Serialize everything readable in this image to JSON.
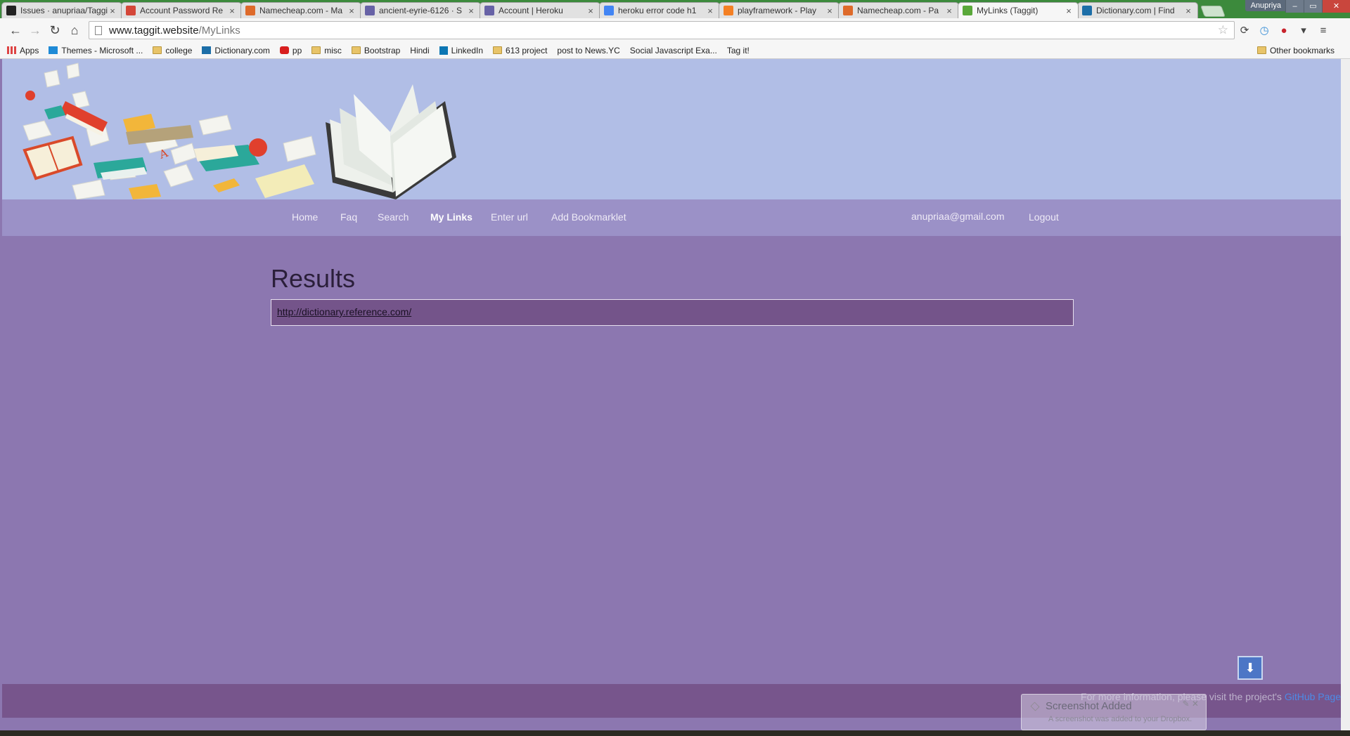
{
  "browser": {
    "tabs": [
      {
        "title": "Issues · anupriaa/Taggit",
        "favicon": "github-icon",
        "color": "#222222"
      },
      {
        "title": "Account Password Re",
        "favicon": "gmail-icon",
        "color": "#d44638"
      },
      {
        "title": "Namecheap.com - Ma",
        "favicon": "namecheap-icon",
        "color": "#de6a2a"
      },
      {
        "title": "ancient-eyrie-6126 · S",
        "favicon": "heroku-icon",
        "color": "#6762a6"
      },
      {
        "title": "Account | Heroku",
        "favicon": "heroku-icon",
        "color": "#6762a6"
      },
      {
        "title": "heroku error code h1",
        "favicon": "google-icon",
        "color": "#4285f4"
      },
      {
        "title": "playframework - Play",
        "favicon": "stackoverflow-icon",
        "color": "#f48024"
      },
      {
        "title": "Namecheap.com - Pa",
        "favicon": "namecheap-icon",
        "color": "#de6a2a"
      },
      {
        "title": "MyLinks (Taggit)",
        "favicon": "play-icon",
        "color": "#5aa83a"
      },
      {
        "title": "Dictionary.com | Find",
        "favicon": "dictionary-icon",
        "color": "#1c6ea8"
      }
    ],
    "active_tab_index": 8,
    "profile_name": "Anupriya",
    "url_host": "www.taggit.website",
    "url_path": "/MyLinks",
    "bookmarks": [
      {
        "label": "Apps",
        "icon": "apps"
      },
      {
        "label": "Themes - Microsoft ...",
        "icon": "ms"
      },
      {
        "label": "college",
        "icon": "folder"
      },
      {
        "label": "Dictionary.com",
        "icon": "dict"
      },
      {
        "label": "pp",
        "icon": "yt"
      },
      {
        "label": "misc",
        "icon": "folder"
      },
      {
        "label": "Bootstrap",
        "icon": "folder"
      },
      {
        "label": "Hindi",
        "icon": "page"
      },
      {
        "label": "LinkedIn",
        "icon": "li"
      },
      {
        "label": "613 project",
        "icon": "folder"
      },
      {
        "label": "post to News.YC",
        "icon": "page"
      },
      {
        "label": "Social Javascript Exa...",
        "icon": "page"
      },
      {
        "label": "Tag it!",
        "icon": "page"
      }
    ],
    "other_bookmarks": "Other bookmarks"
  },
  "nav": {
    "items": [
      {
        "label": "Home",
        "active": false
      },
      {
        "label": "Faq",
        "active": false
      },
      {
        "label": "Search",
        "active": false
      },
      {
        "label": "My Links",
        "active": true
      },
      {
        "label": "Enter url",
        "active": false
      },
      {
        "label": "Add Bookmarklet",
        "active": false
      }
    ],
    "user_email": "anupriaa@gmail.com",
    "logout": "Logout"
  },
  "main": {
    "title": "Results",
    "results": [
      "http://dictionary.reference.com/"
    ]
  },
  "footer": {
    "text": "For more information, please visit the project's ",
    "link": "GitHub Page"
  },
  "toast": {
    "title": "Screenshot Added",
    "subtitle": "A screenshot was added to your Dropbox."
  },
  "colors": {
    "header_bg": "#b1bee6",
    "navbar_bg": "#9b91c7",
    "page_bg": "#8c77b0",
    "result_bg": "#74548a",
    "footer_bg": "#77558c",
    "link_blue": "#4d8ae6"
  }
}
